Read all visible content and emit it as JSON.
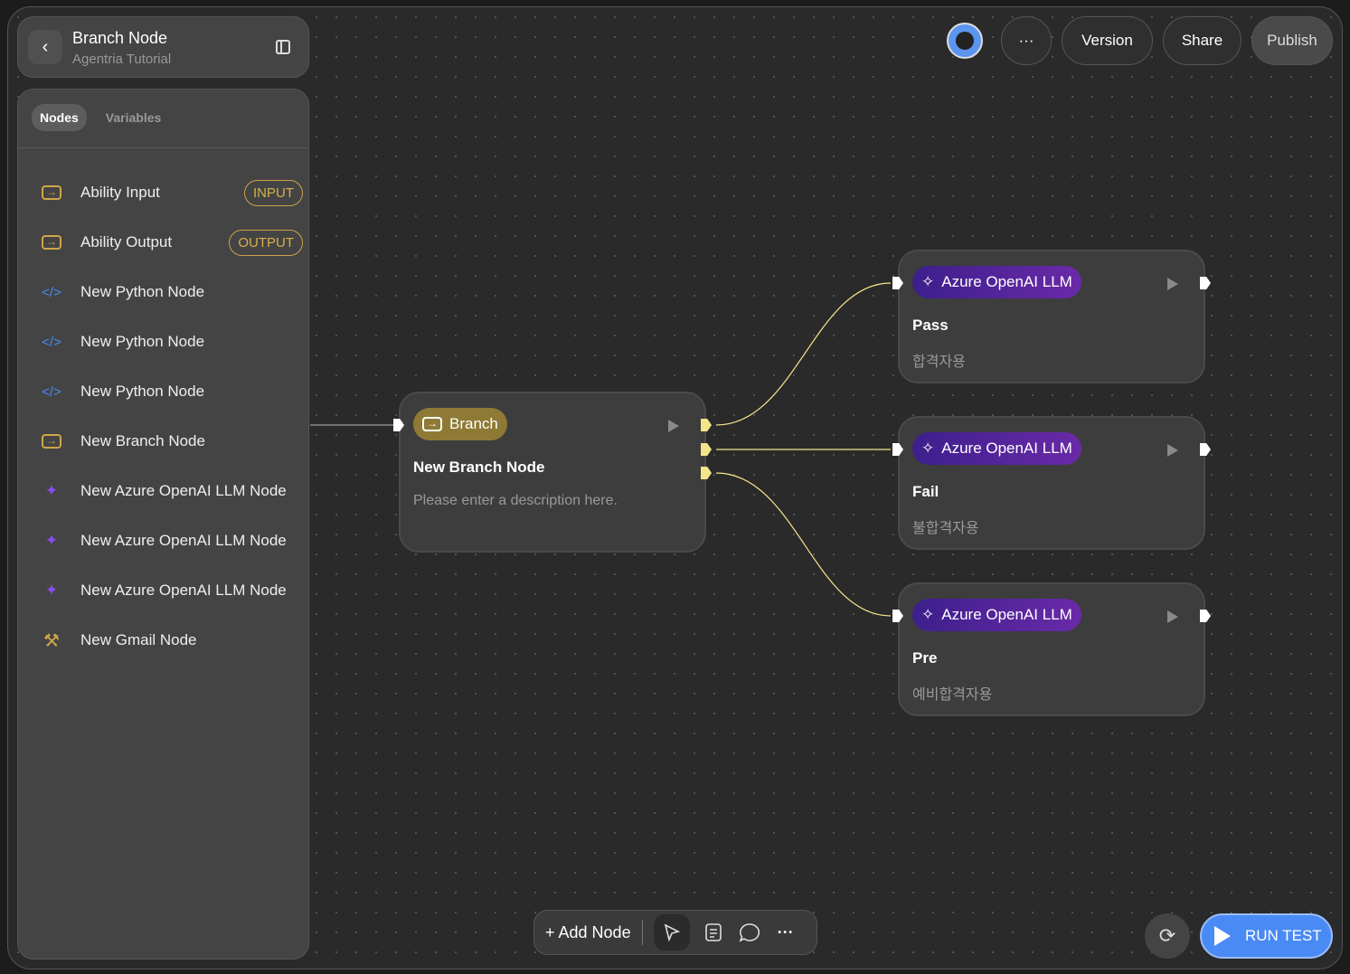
{
  "header": {
    "title": "Branch Node",
    "subtitle": "Agentria Tutorial"
  },
  "sidebar": {
    "tabs": [
      "Nodes",
      "Variables"
    ],
    "active_tab": "Nodes",
    "items": [
      {
        "label": "Ability Input",
        "icon": "arrow-box-icon",
        "badge": "INPUT"
      },
      {
        "label": "Ability Output",
        "icon": "arrow-box-icon",
        "badge": "OUTPUT"
      },
      {
        "label": "New Python Node",
        "icon": "code-icon"
      },
      {
        "label": "New Python Node",
        "icon": "code-icon"
      },
      {
        "label": "New Python Node",
        "icon": "code-icon"
      },
      {
        "label": "New Branch Node",
        "icon": "arrow-box-icon"
      },
      {
        "label": "New Azure OpenAI LLM Node",
        "icon": "sparkle-icon"
      },
      {
        "label": "New Azure OpenAI LLM Node",
        "icon": "sparkle-icon"
      },
      {
        "label": "New Azure OpenAI LLM Node",
        "icon": "sparkle-icon"
      },
      {
        "label": "New Gmail Node",
        "icon": "tools-icon"
      }
    ]
  },
  "topbar": {
    "more": "···",
    "version": "Version",
    "share": "Share",
    "publish": "Publish"
  },
  "nodes": {
    "branch": {
      "type": "Branch",
      "title": "New Branch Node",
      "description": "Please enter a description here."
    },
    "llm": [
      {
        "type": "Azure OpenAI LLM",
        "title": "Pass",
        "description": "합격자용"
      },
      {
        "type": "Azure OpenAI LLM",
        "title": "Fail",
        "description": "불합격자용"
      },
      {
        "type": "Azure OpenAI LLM",
        "title": "Pre",
        "description": "예비합격자용"
      }
    ]
  },
  "toolbar": {
    "add_node": "+ Add Node"
  },
  "run_test": "RUN TEST",
  "colors": {
    "accent": "#4a8af4",
    "branch": "#8e7a35",
    "llm": "#5a25a0",
    "edge": "#f5e58a"
  }
}
